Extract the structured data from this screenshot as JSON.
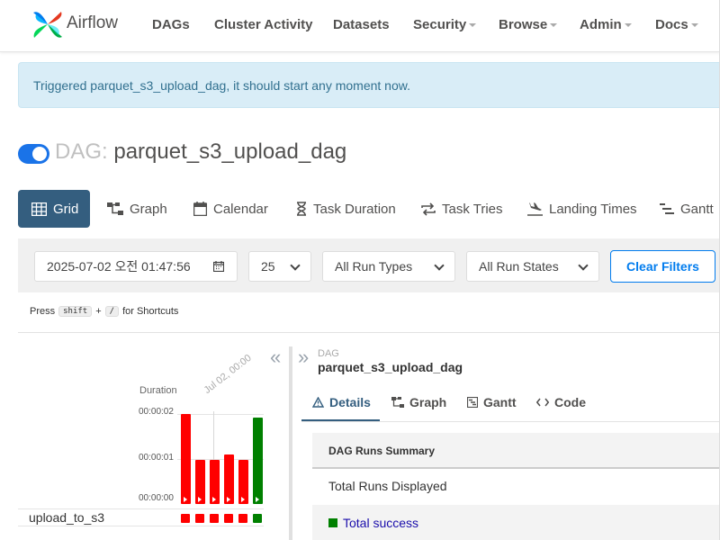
{
  "brand": {
    "name": "Airflow"
  },
  "nav": {
    "items": [
      {
        "label": "DAGs"
      },
      {
        "label": "Cluster Activity"
      },
      {
        "label": "Datasets"
      },
      {
        "label": "Security"
      },
      {
        "label": "Browse"
      },
      {
        "label": "Admin"
      },
      {
        "label": "Docs"
      }
    ]
  },
  "alert": {
    "message": "Triggered parquet_s3_upload_dag, it should start any moment now."
  },
  "dag": {
    "prefix": "DAG:",
    "id": "parquet_s3_upload_dag",
    "active": true
  },
  "views": [
    {
      "label": "Grid",
      "icon": "grid-icon"
    },
    {
      "label": "Graph",
      "icon": "graph-icon"
    },
    {
      "label": "Calendar",
      "icon": "calendar-icon"
    },
    {
      "label": "Task Duration",
      "icon": "hourglass-icon"
    },
    {
      "label": "Task Tries",
      "icon": "retry-icon"
    },
    {
      "label": "Landing Times",
      "icon": "plane-landing-icon"
    },
    {
      "label": "Gantt",
      "icon": "gantt-icon"
    }
  ],
  "filters": {
    "datetime": "2025-07-02 오전 01:47:56",
    "num_runs": "25",
    "run_type": "All Run Types",
    "run_state": "All Run States",
    "clear_label": "Clear Filters"
  },
  "shortcuts": {
    "press": "Press",
    "key1": "shift",
    "plus": "+",
    "key2": "/",
    "suffix": "for Shortcuts"
  },
  "grid": {
    "duration_label": "Duration",
    "date_label": "Jul 02, 00:00",
    "ticks": [
      "00:00:02",
      "00:00:01",
      "00:00:00"
    ],
    "task": "upload_to_s3",
    "runs": [
      {
        "state": "failed",
        "duration_frac": 1.0
      },
      {
        "state": "failed",
        "duration_frac": 0.49
      },
      {
        "state": "failed",
        "duration_frac": 0.49
      },
      {
        "state": "failed",
        "duration_frac": 0.55
      },
      {
        "state": "failed",
        "duration_frac": 0.49
      },
      {
        "state": "success",
        "duration_frac": 0.96
      }
    ],
    "colors": {
      "failed": "#ff0000",
      "success": "#008000"
    }
  },
  "details": {
    "label": "DAG",
    "dag_id": "parquet_s3_upload_dag",
    "tabs": [
      {
        "label": "Details",
        "icon": "warning-triangle-icon"
      },
      {
        "label": "Graph",
        "icon": "graph-icon"
      },
      {
        "label": "Gantt",
        "icon": "gantt-icon"
      },
      {
        "label": "Code",
        "icon": "code-icon"
      }
    ],
    "summary_title": "DAG Runs Summary",
    "total_runs_label": "Total Runs Displayed",
    "total_success_label": "Total success"
  }
}
